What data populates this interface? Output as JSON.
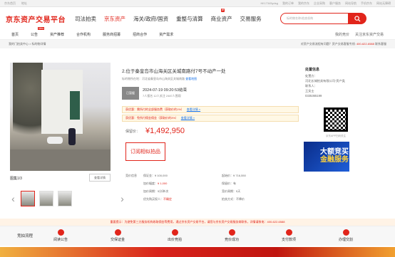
{
  "topbar": {
    "left": [
      "京东首页",
      "地址"
    ],
    "middle": "Hi!17345ydsg",
    "right": [
      "我的订单",
      "我的京东",
      "企业采购",
      "客户服务",
      "网站导航",
      "手机京东",
      "网站无障碍"
    ]
  },
  "header": {
    "logo": "京东资产交易平台",
    "nav": [
      "司法拍卖",
      "京东资产",
      "海关/政府/国资",
      "重整与清算",
      "商业资产",
      "交易服务"
    ],
    "nav_active_index": 1,
    "nav_badge": "新",
    "search_placeholder": "标的物名称/拍卖机构",
    "search_icon": "search-icon"
  },
  "subnav": {
    "items": [
      "首页",
      "公告",
      "资产推荐",
      "合作机构",
      "服务商招募",
      "招商合作",
      "资产需求"
    ],
    "new_tag": "New",
    "right": [
      "我的竞价",
      "关注京东资产交易"
    ]
  },
  "breadcrumb": {
    "text": "我的门拍卖中心 > 标的物详情",
    "hotline_text": "对资产交易流程有问题？资产交易客服专线:",
    "hotline": "400-622-6588",
    "service": "联系客服"
  },
  "gallery": {
    "label": "图集1/3",
    "view_button": "查看详情"
  },
  "item": {
    "title": "2.位于秦皇岛市山海关区关城南路付7号不动产一处",
    "address": "标的物所在地：河北省秦皇岛市山海关区关城南路",
    "map_link": "查看地图",
    "status": "已暂缓",
    "end_time": "2024-07-19 09:20:53结束",
    "stats": "7人报名  12人关注  2487人围观",
    "notice1": "获优惠：需所付的全部服务费（获取价的1%）",
    "notice1_link": "查看详情 »",
    "notice2": "获优惠：免所付佣金佣金（获取价的3%）",
    "notice2_link": "查看详情 »",
    "price_label": "保留价：",
    "price": "¥1,492,950",
    "subscribe": "订阅相似拍品"
  },
  "details": {
    "section": "竞价信息",
    "fields": [
      [
        "保证金：",
        "¥ 100,000"
      ],
      [
        "起始价：",
        "¥ 716,550"
      ],
      [
        "加价幅度：",
        "¥ 1,000"
      ],
      [
        "保留价：",
        "有"
      ],
      [
        "加价周期：",
        "5分钟/次"
      ],
      [
        "竞价周期：",
        "5天"
      ],
      [
        "优先购买权人：",
        "不确定"
      ],
      [
        "拍卖方式：",
        "不降价"
      ]
    ]
  },
  "seller": {
    "title": "处置信息",
    "org_label": "处置方：",
    "org": "河北长城拍卖有限公司-资产类",
    "contact_label": "联系人：",
    "contact": "王女士",
    "phone": "0335365199",
    "qr_caption": "京东APP扫码关注"
  },
  "banner": {
    "line1": "大额竞买",
    "line2": "金融服务"
  },
  "warning": "重要提示：为避免第三方服务机构收取佣金等费用，通过京东资产交易平台，请您与京东资产交易服务商联系，详情请致电：400-622-6588",
  "process": {
    "label": "竞拍流程",
    "steps": [
      "阅读公告",
      "交保证金",
      "出价竞拍",
      "竞价成功",
      "支付款项",
      "办理交割"
    ]
  },
  "colors": {
    "brand": "#e1251b",
    "link": "#1a73e8",
    "banner": "#1f5ed8"
  }
}
